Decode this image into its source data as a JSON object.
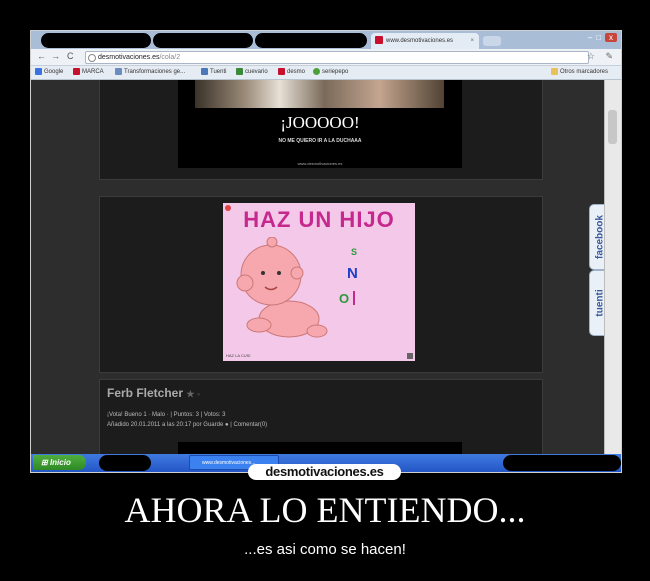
{
  "browser": {
    "tab_title": "www.desmotivaciones.es",
    "url_host": "desmotivaciones.es",
    "url_path": "/cola/2",
    "bookmarks": [
      {
        "label": "Google",
        "icon": "google-icon",
        "color": "#3a73e0"
      },
      {
        "label": "MARCA",
        "icon": "marca-icon",
        "color": "#c8102e"
      },
      {
        "label": "Transformaciones ge...",
        "icon": "page-icon",
        "color": "#6a8cc0"
      },
      {
        "label": "Tuenti",
        "icon": "tuenti-icon",
        "color": "#4a78b8"
      },
      {
        "label": "cuevario",
        "icon": "cuevario-icon",
        "color": "#3b8a3b"
      },
      {
        "label": "desmo",
        "icon": "desmo-icon",
        "color": "#c8102e"
      },
      {
        "label": "seriepepo",
        "icon": "seriepepo-icon",
        "color": "#4ba03a"
      }
    ],
    "other_bookmarks": "Otros marcadores"
  },
  "posts": {
    "first": {
      "title": "¡JOOOOO!",
      "subtitle": "NO ME QUIERO IR A LA DUCHAAA",
      "watermark": "www.desmotivaciones.es"
    },
    "second": {
      "heading": "HAZ UN HIJO",
      "letter_s": "S",
      "letter_n": "N",
      "letter_o": "O",
      "caption": "HAZ LA CUSI"
    },
    "third": {
      "author": "Ferb Fletcher",
      "line1": "¡Vota! Bueno 1 · Malo · | Puntos: 3 | Votos: 3",
      "line2": "Añadido 20.01.2011 a las 20:17 por Guarde ● | Comentar(0)"
    }
  },
  "sidebar": {
    "facebook": "facebook",
    "tuenti": "tuenti"
  },
  "taskbar": {
    "start": "Inicio",
    "task": "www.desmotivaciones..."
  },
  "poster": {
    "logo": "desmotivaciones.es",
    "title": "AHORA LO ENTIENDO...",
    "subtitle": "...es asi como se hacen!"
  },
  "colors": {
    "pink_bg": "#f4c8e8",
    "heading_pink": "#c6298e",
    "facebook_blue": "#3b5998"
  }
}
